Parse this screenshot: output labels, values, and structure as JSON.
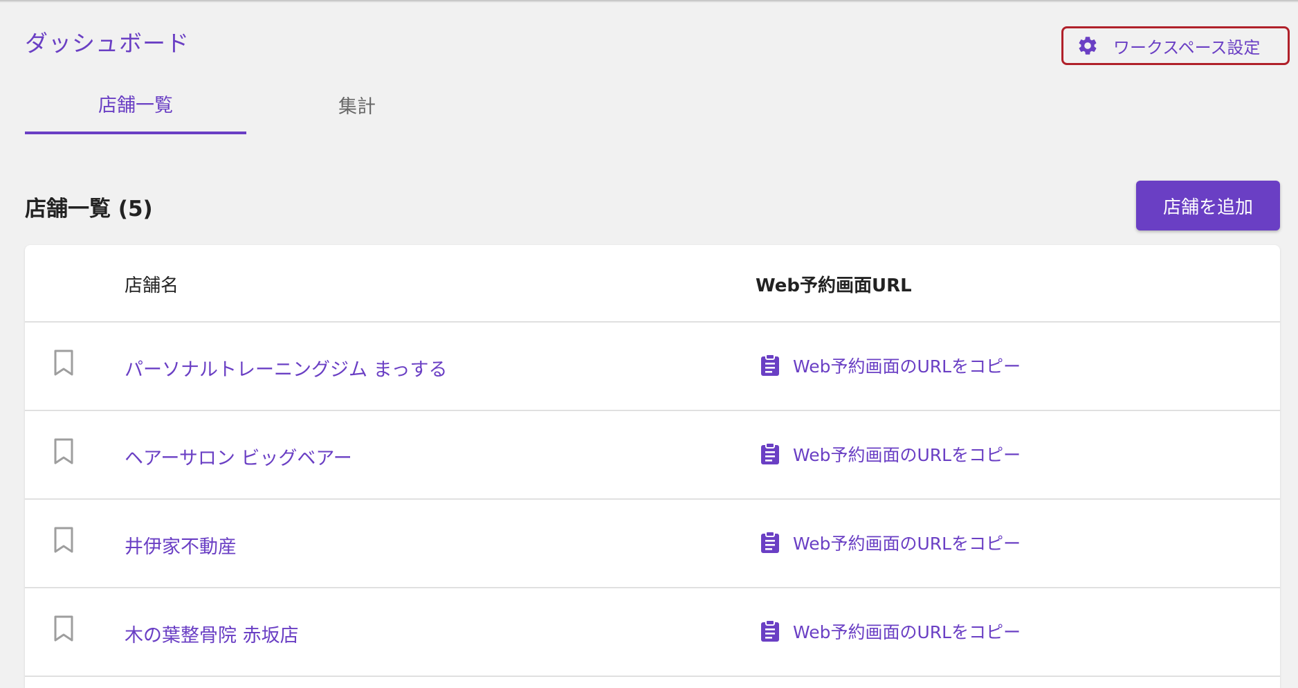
{
  "header": {
    "title": "ダッシュボード",
    "workspace_settings_label": "ワークスペース設定"
  },
  "tabs": [
    {
      "label": "店舗一覧",
      "active": true
    },
    {
      "label": "集計",
      "active": false
    }
  ],
  "section": {
    "title": "店舗一覧 (5)",
    "add_button_label": "店舗を追加"
  },
  "table": {
    "columns": [
      "店舗名",
      "Web予約画面URL"
    ],
    "rows": [
      {
        "name": "パーソナルトレーニングジム まっする",
        "url_action": "Web予約画面のURLをコピー"
      },
      {
        "name": "ヘアーサロン ビッグベアー",
        "url_action": "Web予約画面のURLをコピー"
      },
      {
        "name": "井伊家不動産",
        "url_action": "Web予約画面のURLをコピー"
      },
      {
        "name": "木の葉整骨院 赤坂店",
        "url_action": "Web予約画面のURLをコピー"
      }
    ]
  },
  "colors": {
    "accent": "#6a3fc4",
    "highlight_border": "#b0202a",
    "background": "#f1f1f1"
  },
  "icons": {
    "settings": "gear-icon",
    "row_marker": "bookmark-icon",
    "copy": "clipboard-icon"
  }
}
